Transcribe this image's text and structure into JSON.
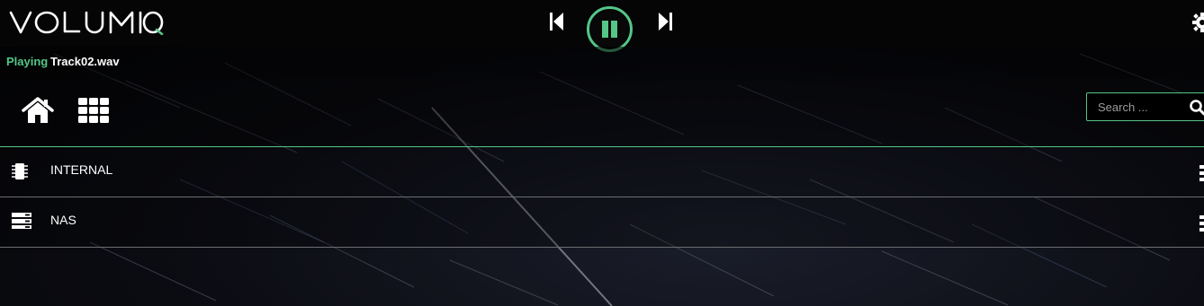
{
  "app": {
    "logo_text": "VOLUMIO"
  },
  "player": {
    "status_label": "Playing",
    "track": "Track02.wav",
    "state": "playing"
  },
  "search": {
    "placeholder": "Search ..."
  },
  "sources": [
    {
      "label": "INTERNAL",
      "icon": "chip-icon"
    },
    {
      "label": "NAS",
      "icon": "server-icon"
    }
  ],
  "colors": {
    "accent": "#54c688",
    "topbar": "#050505",
    "divider": "#6a6e70"
  }
}
